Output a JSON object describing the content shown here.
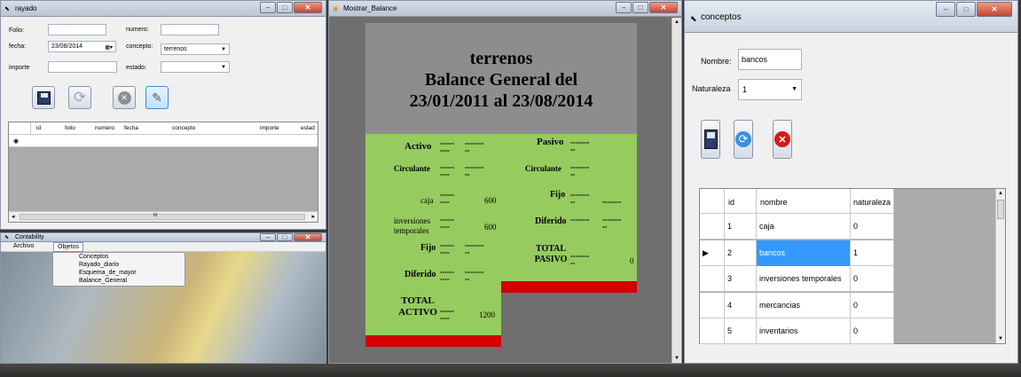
{
  "rayado": {
    "title": "rayado",
    "folio_label": "Folio:",
    "numero_label": "numero:",
    "fecha_label": "fecha:",
    "fecha_value": "23/08/2014",
    "concepto_label": "concepto:",
    "concepto_value": "terrenos",
    "importe_label": "importe",
    "estado_label": "estado:",
    "grid_headers": [
      "id",
      "folio",
      "numero",
      "fecha",
      "concepto",
      "importe",
      "estad"
    ],
    "new_row_marker": "◉",
    "scroll_mark": "III"
  },
  "contability": {
    "title": "Contability",
    "menu": [
      "Archivo",
      "Objetos"
    ],
    "submenu": [
      "Conceptos",
      "Rayado_diario",
      "Esquema_de_mayor",
      "Balance_General"
    ]
  },
  "balance": {
    "title": "Mostrar_Balance",
    "heading_line1": "terrenos",
    "heading_line2": "Balance General del",
    "heading_line3": "23/01/2011 al 23/08/2014",
    "left": {
      "activo": "Activo",
      "circulante": "Circulante",
      "caja": "caja",
      "caja_value": "600",
      "inversiones": "inversiones temporales",
      "inversiones_value": "600",
      "fijo": "Fijo",
      "diferido": "Diferido",
      "total_activo": "TOTAL ACTIVO",
      "total_activo_value": "1200"
    },
    "right": {
      "pasivo": "Pasivo",
      "circulante": "Circulante",
      "fijo": "Fijo",
      "diferido": "Diferido",
      "total_pasivo": "TOTAL PASIVO",
      "total_pasivo_value": "0"
    },
    "dash_long": "------",
    "dash_mid": "--------",
    "dash_short": "----",
    "dash_tiny": "--"
  },
  "conceptos": {
    "title": "conceptos",
    "nombre_label": "Nombre:",
    "nombre_value": "bancos",
    "naturaleza_label": "Naturaleza",
    "naturaleza_value": "1",
    "grid_headers": [
      "id",
      "nombre",
      "naturaleza"
    ],
    "rows": [
      {
        "id": "1",
        "nombre": "caja",
        "naturaleza": "0"
      },
      {
        "id": "2",
        "nombre": "bancos",
        "naturaleza": "1"
      },
      {
        "id": "3",
        "nombre": "inversiones temporales",
        "naturaleza": "0"
      },
      {
        "id": "4",
        "nombre": "mercancias",
        "naturaleza": "0"
      },
      {
        "id": "5",
        "nombre": "inventarios",
        "naturaleza": "0"
      }
    ],
    "selected_row_index": 1
  },
  "colors": {
    "balance_green": "#95cb5f",
    "balance_gray": "#8d8d8d",
    "balance_red": "#d20000",
    "selection_blue": "#3399ff"
  }
}
